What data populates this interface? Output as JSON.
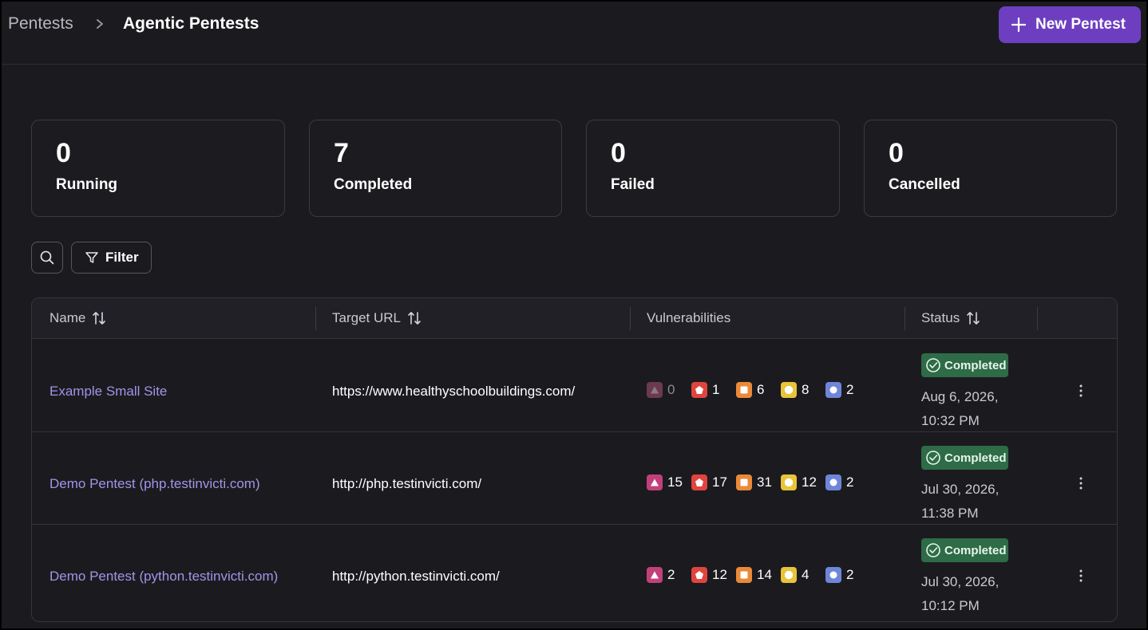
{
  "header": {
    "breadcrumb_root": "Pentests",
    "breadcrumb_current": "Agentic Pentests",
    "new_button_label": "New Pentest"
  },
  "stats": [
    {
      "value": "0",
      "label": "Running"
    },
    {
      "value": "7",
      "label": "Completed"
    },
    {
      "value": "0",
      "label": "Failed"
    },
    {
      "value": "0",
      "label": "Cancelled"
    }
  ],
  "toolbar": {
    "filter_label": "Filter"
  },
  "table": {
    "columns": {
      "name": "Name",
      "target_url": "Target URL",
      "vulnerabilities": "Vulnerabilities",
      "status": "Status"
    },
    "rows": [
      {
        "name": "Example Small Site",
        "url": "https://www.healthyschoolbuildings.com/",
        "vulns": {
          "critical": "0",
          "high": "1",
          "medium": "6",
          "low": "8",
          "info": "2"
        },
        "status": "Completed",
        "date_line1": "Aug 6, 2026,",
        "date_line2": "10:32 PM"
      },
      {
        "name": "Demo Pentest (php.testinvicti.com)",
        "url": "http://php.testinvicti.com/",
        "vulns": {
          "critical": "15",
          "high": "17",
          "medium": "31",
          "low": "12",
          "info": "2"
        },
        "status": "Completed",
        "date_line1": "Jul 30, 2026,",
        "date_line2": "11:38 PM"
      },
      {
        "name": "Demo Pentest (python.testinvicti.com)",
        "url": "http://python.testinvicti.com/",
        "vulns": {
          "critical": "2",
          "high": "12",
          "medium": "14",
          "low": "4",
          "info": "2"
        },
        "status": "Completed",
        "date_line1": "Jul 30, 2026,",
        "date_line2": "10:12 PM"
      }
    ]
  },
  "colors": {
    "accent": "#6d3fc0",
    "critical": "#c2407a",
    "critical_muted": "#6b3a4f",
    "high": "#e0443f",
    "medium": "#e98a3a",
    "low": "#e8c43a",
    "info": "#6f86d8",
    "status_completed": "#2e6b47"
  },
  "icons": {
    "breadcrumb_separator": "chevron-right-icon",
    "new_button": "plus-icon",
    "search": "search-icon",
    "filter": "filter-icon",
    "sort": "sort-icon",
    "status": "check-circle-icon",
    "row_menu": "kebab-menu-icon",
    "critical": "triangle-icon",
    "high": "pentagon-icon",
    "medium": "square-icon",
    "low": "octagon-icon",
    "info": "circle-icon"
  }
}
